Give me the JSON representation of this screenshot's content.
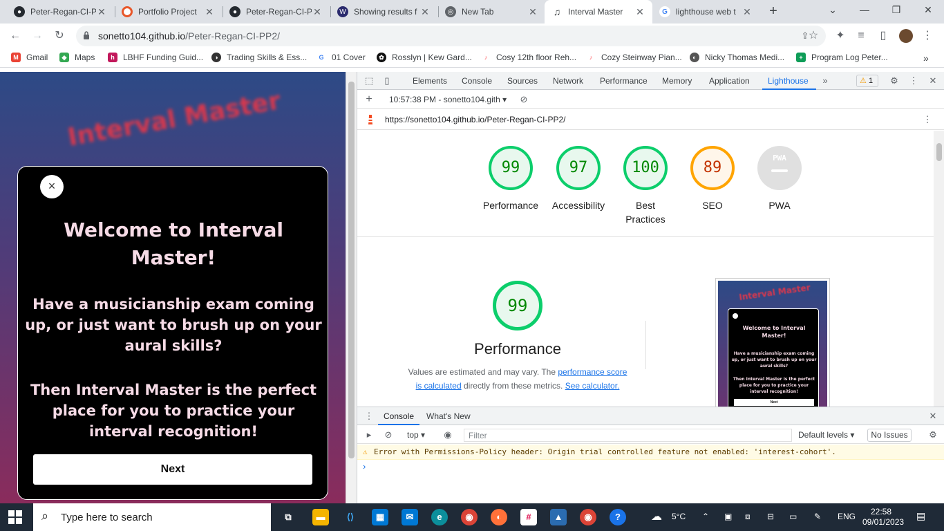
{
  "browser": {
    "tabs": [
      {
        "label": "Peter-Regan-CI-P",
        "icon": "github-icon"
      },
      {
        "label": "Portfolio Project",
        "icon": "portfolio-icon"
      },
      {
        "label": "Peter-Regan-CI-P",
        "icon": "github-icon"
      },
      {
        "label": "Showing results f",
        "icon": "search-results-icon"
      },
      {
        "label": "New Tab",
        "icon": "chrome-icon"
      },
      {
        "label": "Interval Master",
        "icon": "music-note-icon",
        "active": true
      },
      {
        "label": "lighthouse web t",
        "icon": "google-icon"
      }
    ],
    "url_host": "sonetto104.github.io",
    "url_path": "/Peter-Regan-CI-PP2/",
    "bookmarks": [
      {
        "label": "Gmail",
        "color": "#ea4335"
      },
      {
        "label": "Maps",
        "color": "#34a853"
      },
      {
        "label": "LBHF Funding Guid...",
        "color": "#c2185b"
      },
      {
        "label": "Trading Skills & Ess...",
        "color": "#333333"
      },
      {
        "label": "01 Cover",
        "color": "#4285f4"
      },
      {
        "label": "Rosslyn | Kew Gard...",
        "color": "#111111"
      },
      {
        "label": "Cosy 12th floor Reh...",
        "color": "#ff5a5f"
      },
      {
        "label": "Cozy Steinway Pian...",
        "color": "#ff5a5f"
      },
      {
        "label": "Nicky Thomas Medi...",
        "color": "#555555"
      },
      {
        "label": "Program Log Peter...",
        "color": "#0f9d58"
      }
    ]
  },
  "page": {
    "title": "Interval Master",
    "modal": {
      "heading": "Welcome to Interval Master!",
      "paragraph1": "Have a musicianship exam coming up, or just want to brush up on your aural skills?",
      "paragraph2": "Then Interval Master is the perfect place for you to practice your interval recognition!",
      "next_label": "Next",
      "close_symbol": "×"
    }
  },
  "devtools": {
    "tabs": [
      "Elements",
      "Console",
      "Sources",
      "Network",
      "Performance",
      "Memory",
      "Application",
      "Lighthouse"
    ],
    "active_tab": "Lighthouse",
    "warning_count": "1",
    "report_time": "10:57:38 PM - sonetto104.gith",
    "report_url": "https://sonetto104.github.io/Peter-Regan-CI-PP2/",
    "scores": [
      {
        "value": "99",
        "label": "Performance",
        "status": "pass"
      },
      {
        "value": "97",
        "label": "Accessibility",
        "status": "pass"
      },
      {
        "value": "100",
        "label": "Best Practices",
        "status": "pass"
      },
      {
        "value": "89",
        "label": "SEO",
        "status": "average"
      },
      {
        "value": "PWA",
        "label": "PWA",
        "status": "na"
      }
    ],
    "performance": {
      "score": "99",
      "title": "Performance",
      "desc_prefix": "Values are estimated and may vary. The ",
      "desc_link1": "performance score is calculated",
      "desc_middle": " directly from these metrics. ",
      "desc_link2": "See calculator."
    },
    "thumbnail": {
      "title": "Interval Master",
      "heading": "Welcome to Interval Master!",
      "p1": "Have a musicianship exam coming up, or just want to brush up on your aural skills?",
      "p2": "Then Interval Master is the perfect place for you to practice your interval recognition!",
      "next": "Next"
    },
    "drawer": {
      "tabs": [
        "Console",
        "What's New"
      ],
      "context": "top",
      "filter_placeholder": "Filter",
      "levels": "Default levels",
      "issues": "No Issues",
      "warning_message": "Error with Permissions-Policy header: Origin trial controlled feature not enabled: 'interest-cohort'.",
      "prompt": "›"
    }
  },
  "taskbar": {
    "search_placeholder": "Type here to search",
    "weather": "5°C",
    "language": "ENG",
    "time": "22:58",
    "date": "09/01/2023"
  },
  "colors": {
    "pass": "#0cce6b",
    "average": "#ffa400",
    "accent": "#1a73e8"
  }
}
